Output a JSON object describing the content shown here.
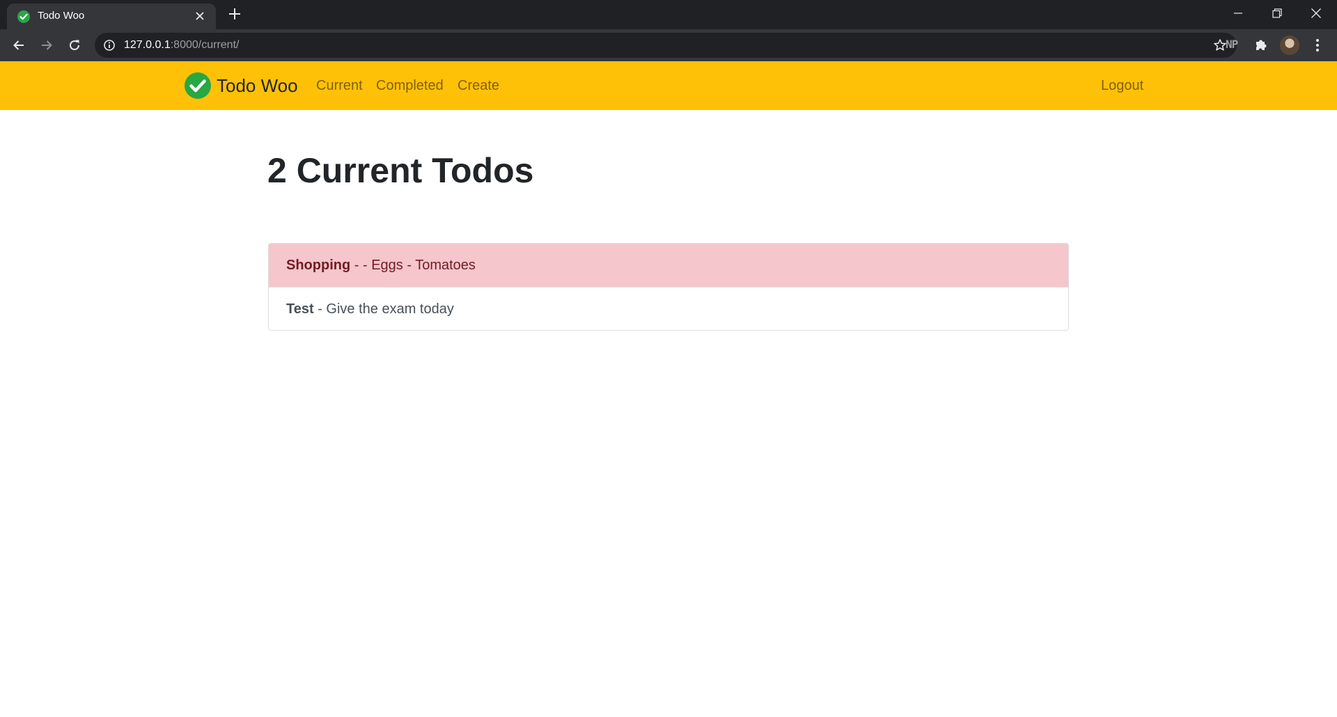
{
  "browser": {
    "tab": {
      "title": "Todo Woo"
    },
    "address_bar": {
      "host": "127.0.0.1",
      "path": ":8000/current/"
    },
    "extension_label": "NP"
  },
  "navbar": {
    "brand": "Todo Woo",
    "links": {
      "current": "Current",
      "completed": "Completed",
      "create": "Create"
    },
    "logout": "Logout",
    "background_color": "#ffc107"
  },
  "main": {
    "title": "2 Current Todos",
    "todos": [
      {
        "title": "Shopping",
        "separator": " - ",
        "memo": "- Eggs - Tomatoes",
        "style": "danger"
      },
      {
        "title": "Test",
        "separator": " - ",
        "memo": "Give the exam today",
        "style": "normal"
      }
    ]
  },
  "colors": {
    "important_bg": "#f5c6cb",
    "important_text": "#721c24",
    "check_green": "#28a745"
  }
}
